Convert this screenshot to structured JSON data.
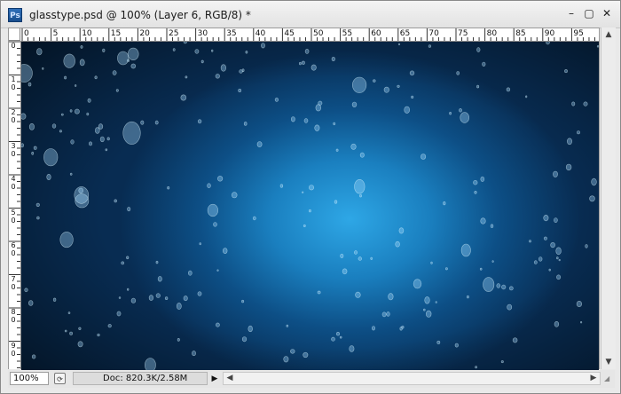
{
  "window": {
    "title": "glasstype.psd @ 100% (Layer 6, RGB/8) *",
    "app_icon_label": "Ps",
    "buttons": {
      "minimize": "–",
      "maximize": "▢",
      "close": "✕"
    }
  },
  "ruler": {
    "horizontal_labels": [
      "0",
      "5",
      "10",
      "15",
      "20",
      "25",
      "30",
      "35",
      "40",
      "45",
      "50",
      "55",
      "60",
      "65",
      "70",
      "75",
      "80",
      "85",
      "90",
      "95"
    ],
    "vertical_labels": [
      "0",
      "1 0",
      "2 0",
      "3 0",
      "4 0",
      "5 0",
      "6 0",
      "7 0",
      "8 0",
      "9 0"
    ]
  },
  "statusbar": {
    "zoom": "100%",
    "doc_info": "Doc: 820.3K/2.58M",
    "doc_menu_arrow": "▶"
  },
  "scrollbars": {
    "up": "▲",
    "down": "▼",
    "left": "◀",
    "right": "▶"
  },
  "canvas": {
    "colors": {
      "center": "#2ea7e6",
      "mid": "#1a7fbf",
      "edge": "#082c52"
    }
  }
}
